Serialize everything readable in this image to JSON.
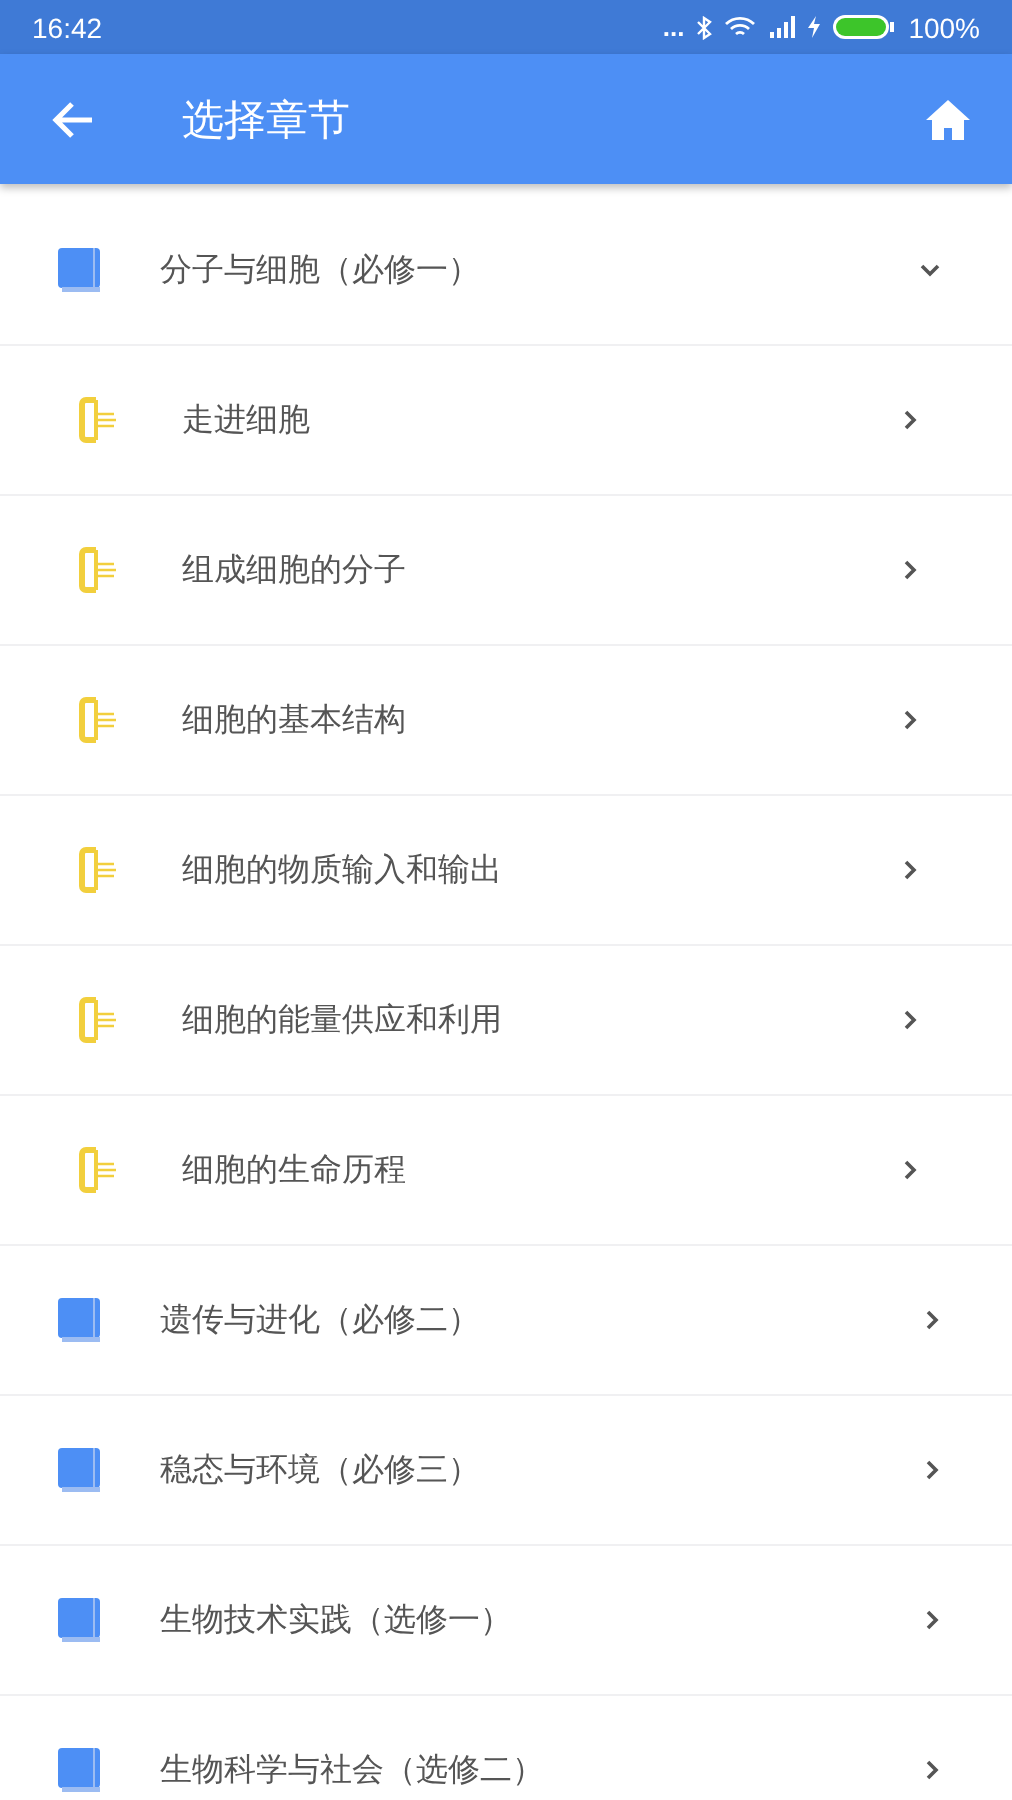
{
  "status_bar": {
    "time": "16:42",
    "dots": "...",
    "battery": "100%"
  },
  "app_bar": {
    "title": "选择章节"
  },
  "chapters": [
    {
      "title": "分子与细胞（必修一）",
      "expanded": true,
      "children": [
        {
          "title": "走进细胞"
        },
        {
          "title": "组成细胞的分子"
        },
        {
          "title": "细胞的基本结构"
        },
        {
          "title": "细胞的物质输入和输出"
        },
        {
          "title": "细胞的能量供应和利用"
        },
        {
          "title": "细胞的生命历程"
        }
      ]
    },
    {
      "title": "遗传与进化（必修二）",
      "expanded": false
    },
    {
      "title": "稳态与环境（必修三）",
      "expanded": false
    },
    {
      "title": "生物技术实践（选修一）",
      "expanded": false
    },
    {
      "title": "生物科学与社会（选修二）",
      "expanded": false
    }
  ]
}
